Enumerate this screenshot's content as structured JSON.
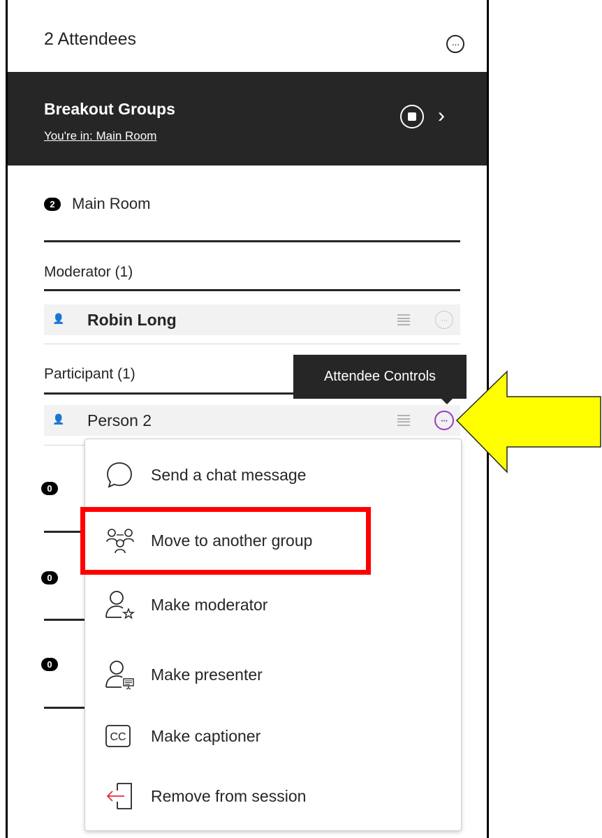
{
  "header": {
    "title": "2 Attendees",
    "more_icon": "more-horizontal-circle-icon"
  },
  "breakout": {
    "title": "Breakout Groups",
    "subtitle": "You're in: Main Room"
  },
  "room": {
    "count": "2",
    "name": "Main Room"
  },
  "moderators": {
    "heading": "Moderator (1)",
    "items": [
      {
        "name": "Robin Long"
      }
    ]
  },
  "participants": {
    "heading": "Participant (1)",
    "items": [
      {
        "name": "Person 2"
      }
    ]
  },
  "tooltip": {
    "text": "Attendee Controls"
  },
  "other_groups": [
    {
      "count": "0"
    },
    {
      "count": "0"
    },
    {
      "count": "0"
    }
  ],
  "menu": {
    "items": [
      {
        "label": "Send a chat message",
        "icon": "chat-bubble-icon"
      },
      {
        "label": "Move to another group",
        "icon": "move-group-icon"
      },
      {
        "label": "Make moderator",
        "icon": "moderator-icon"
      },
      {
        "label": "Make presenter",
        "icon": "presenter-icon"
      },
      {
        "label": "Make captioner",
        "icon": "closed-caption-icon"
      },
      {
        "label": "Remove from session",
        "icon": "remove-from-session-icon"
      }
    ]
  },
  "colors": {
    "dark": "#262626",
    "accent_purple": "#9b3ac6",
    "highlight_red": "#ff0000",
    "arrow_yellow": "#ffff00"
  }
}
